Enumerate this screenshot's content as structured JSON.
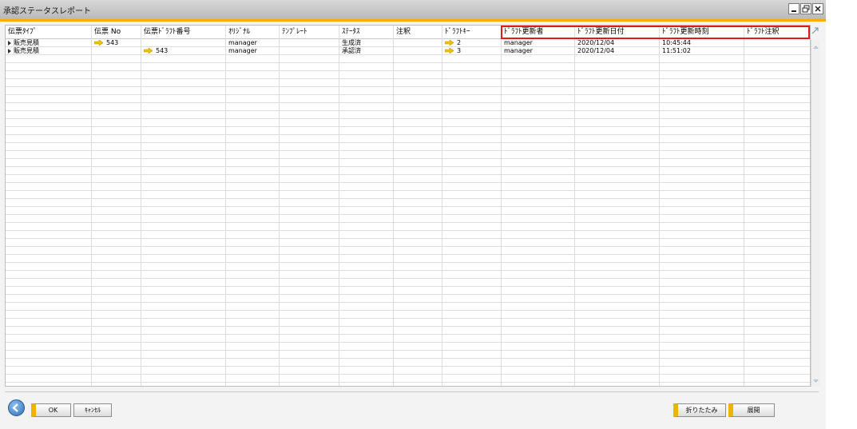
{
  "window": {
    "title": "承認ステータスレポート",
    "controls": [
      "minimize-icon",
      "restore-icon",
      "close-icon"
    ]
  },
  "grid": {
    "columns": [
      "伝票ﾀｲﾌﾟ",
      "伝票 No",
      "伝票ﾄﾞﾗﾌﾄ番号",
      "ｵﾘｼﾞﾅﾙ",
      "ﾃﾝﾌﾟﾚｰﾄ",
      "ｽﾃｰﾀｽ",
      "注釈",
      "ﾄﾞﾗﾌﾄｷｰ",
      "ﾄﾞﾗﾌﾄ更新者",
      "ﾄﾞﾗﾌﾄ更新日付",
      "ﾄﾞﾗﾌﾄ更新時刻",
      "ﾄﾞﾗﾌﾄ注釈"
    ],
    "highlighted_columns": [
      "ﾄﾞﾗﾌﾄ更新者",
      "ﾄﾞﾗﾌﾄ更新日付",
      "ﾄﾞﾗﾌﾄ更新時刻",
      "ﾄﾞﾗﾌﾄ注釈"
    ],
    "rows": [
      {
        "doc_type": "販売見積",
        "doc_no": "543",
        "draft_no": "",
        "original": "manager",
        "template": "",
        "status": "生成済",
        "remarks": "",
        "draft_key": "2",
        "draft_updater": "manager",
        "draft_update_date": "2020/12/04",
        "draft_update_time": "10:45:44",
        "draft_remarks": ""
      },
      {
        "doc_type": "販売見積",
        "doc_no": "",
        "draft_no": "543",
        "original": "manager",
        "template": "",
        "status": "承認済",
        "remarks": "",
        "draft_key": "3",
        "draft_updater": "manager",
        "draft_update_date": "2020/12/04",
        "draft_update_time": "11:51:02",
        "draft_remarks": ""
      }
    ]
  },
  "footer": {
    "ok_label": "OK",
    "cancel_label": "ｷｬﾝｾﾙ",
    "collapse_label": "折りたたみ",
    "expand_label": "展開"
  },
  "colors": {
    "accent": "#f0b400",
    "highlight_box": "#e21a1a",
    "link_arrow": "#f2c200"
  }
}
